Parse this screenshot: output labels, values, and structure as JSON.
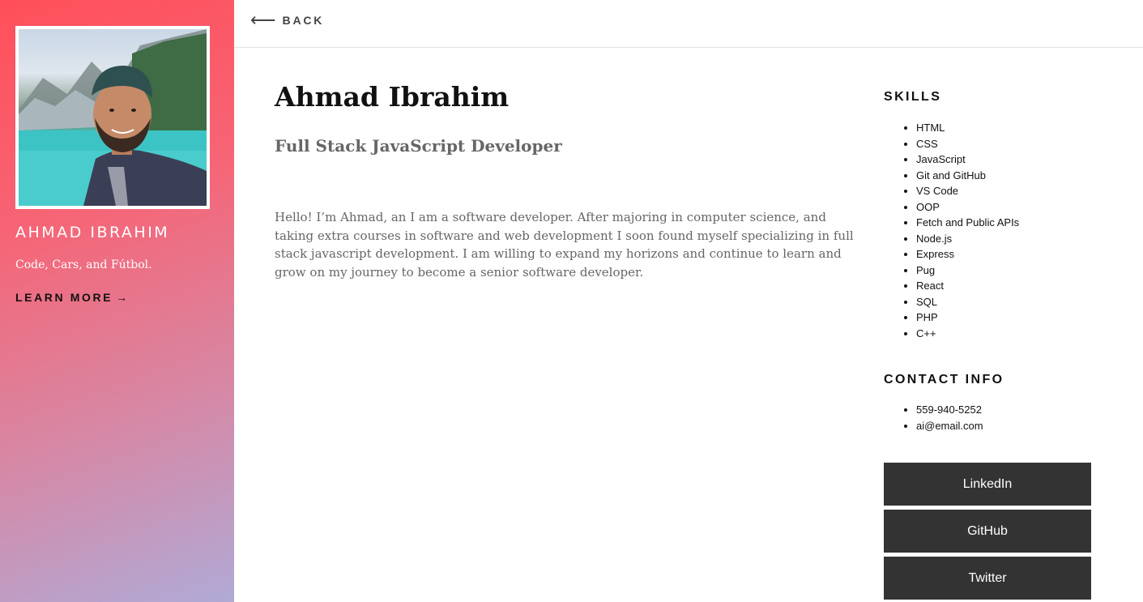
{
  "sidebar": {
    "name": "Ahmad Ibrahim",
    "tagline": "Code, Cars, and Fútbol.",
    "learn_more": "LEARN MORE",
    "learn_more_arrow": "→"
  },
  "topbar": {
    "back_arrow": "⟵",
    "back_label": "BACK"
  },
  "main": {
    "name": "Ahmad Ibrahim",
    "title": "Full Stack JavaScript Developer",
    "bio": "Hello! I’m Ahmad, an I am a software developer. After majoring in computer science, and taking extra courses in software and web development I soon found myself specializing in full stack javascript development. I am willing to expand my horizons and continue to learn and grow on my journey to become a senior software developer."
  },
  "skills": {
    "heading": "SKILLS",
    "items": [
      "HTML",
      "CSS",
      "JavaScript",
      "Git and GitHub",
      "VS Code",
      "OOP",
      "Fetch and Public APIs",
      "Node.js",
      "Express",
      "Pug",
      "React",
      "SQL",
      "PHP",
      "C++"
    ]
  },
  "contact": {
    "heading": "CONTACT INFO",
    "items": [
      "559-940-5252",
      "ai@email.com"
    ]
  },
  "social": {
    "linkedin": "LinkedIn",
    "github": "GitHub",
    "twitter": "Twitter"
  },
  "colors": {
    "gradient_top": "#ff4f5a",
    "gradient_bottom": "#b0aad6",
    "button_bg": "#333333"
  }
}
